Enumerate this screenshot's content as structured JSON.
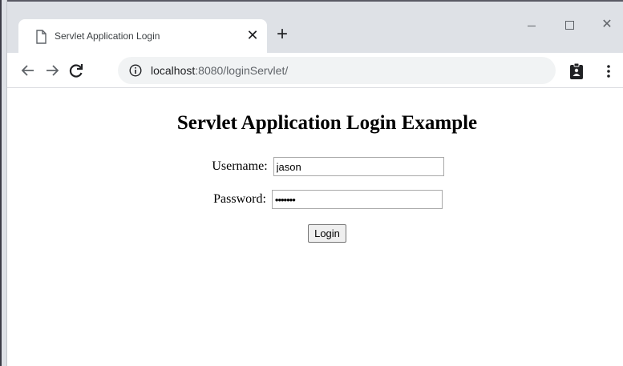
{
  "tab": {
    "title": "Servlet Application Login",
    "close_icon": "close-icon",
    "new_tab_icon": "plus-icon"
  },
  "window_controls": {
    "minimize_icon": "minimize-icon",
    "maximize_icon": "maximize-icon",
    "close_icon": "close-icon"
  },
  "toolbar": {
    "url_host": "localhost",
    "url_rest": ":8080/loginServlet/",
    "icons": [
      "back-arrow-icon",
      "forward-arrow-icon",
      "reload-icon",
      "info-icon",
      "clipboard-icon",
      "menu-icon"
    ]
  },
  "page": {
    "heading": "Servlet Application Login Example",
    "username_label": "Username:",
    "username_value": "jason",
    "password_label": "Password:",
    "password_value": "•••••••",
    "login_button": "Login"
  },
  "colors": {
    "titlebar_bg": "#dee1e6",
    "omnibox_bg": "#f1f3f4",
    "icon": "#5f6368"
  }
}
